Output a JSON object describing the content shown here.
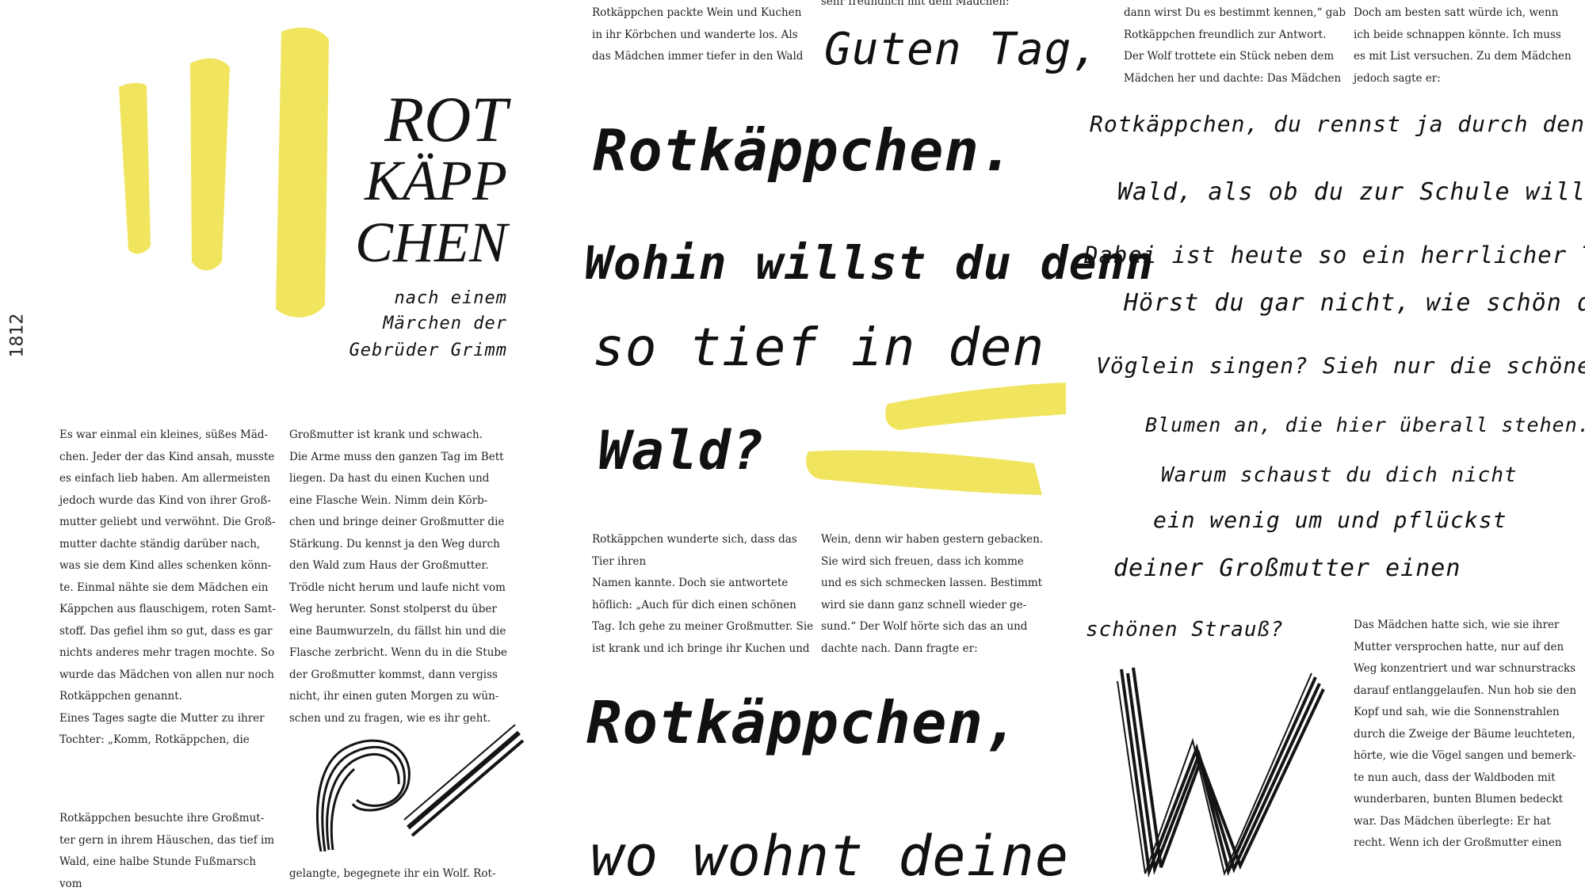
{
  "colors": {
    "accent_yellow": "#F1E45E",
    "ink": "#141414",
    "paper": "#FFFFFF"
  },
  "year": "1812",
  "title": {
    "line1": "ROT",
    "line2": "KÄPP",
    "line3": "CHEN",
    "subtitle_line1": "nach einem",
    "subtitle_line2": "Märchen der",
    "subtitle_line3": "Gebrüder Grimm"
  },
  "page1": {
    "col1_a": "Es war einmal ein kleines, süßes Mäd-\nchen. Jeder der das Kind ansah, musste\nes einfach lieb haben. Am allermeisten\njedoch wurde das Kind von ihrer Groß-\nmutter geliebt und verwöhnt. Die Groß-\nmutter dachte ständig darüber nach,\nwas sie dem Kind alles schenken könn-\nte. Einmal nähte sie dem Mädchen ein\nKäppchen aus flauschigem, roten Samt-\nstoff. Das gefiel ihm so gut, dass es gar\nnichts anderes mehr tragen mochte. So\nwurde das Mädchen von allen nur noch\nRotkäppchen genannt.\nEines Tages sagte die Mutter zu ihrer\nTochter: „Komm, Rotkäppchen, die",
    "col1_b": "Rotkäppchen besuchte ihre Großmut-\nter gern in ihrem Häuschen, das tief im\nWald, eine halbe Stunde Fußmarsch vom",
    "col2_a": "Großmutter ist krank und schwach.\nDie Arme muss den ganzen Tag im Bett\nliegen. Da hast du einen Kuchen und\neine Flasche Wein. Nimm dein Körb-\nchen und bringe deiner Großmutter die\nStärkung. Du kennst ja den Weg durch\nden Wald zum Haus der Großmutter.\nTrödle nicht herum und laufe nicht vom\nWeg herunter. Sonst stolperst du über\neine Baumwurzeln, du fällst hin und die\nFlasche zerbricht. Wenn du in die Stube\nder Großmutter kommst, dann vergiss\nnicht, ihr einen guten Morgen zu wün-\nschen und zu fragen, wie es ihr geht.",
    "col2_b": "gelangte, begegnete ihr ein Wolf. Rot-"
  },
  "page2": {
    "col1_top": "Rotkäppchen packte Wein und Kuchen\nin ihr Körbchen und wanderte los. Als\ndas Mädchen immer tiefer in den Wald",
    "col2_top": "sehr freundlich mit dem Mädchen:",
    "hand_guten_tag": "Guten Tag,",
    "hand_rotkappchen": "Rotkäppchen.",
    "hand_wohin": "Wohin willst du denn",
    "hand_so_tief": "so tief in den",
    "hand_wald": "Wald?",
    "col1_mid": "Rotkäppchen wunderte sich, dass das\nTier ihren\nNamen kannte. Doch sie antwortete\nhöflich: „Auch für dich einen schönen\nTag. Ich gehe zu meiner Großmutter. Sie\nist krank und ich bringe ihr Kuchen und",
    "col2_mid": "Wein, denn wir haben  gestern gebacken.\nSie wird sich freuen, dass ich komme\nund es sich schmecken lassen. Bestimmt\nwird sie dann ganz schnell wieder ge-\nsund.“ Der Wolf hörte sich das an und\ndachte nach. Dann fragte er:",
    "hand_rotkappchen2": "Rotkäppchen,",
    "hand_wo_wohnt": "wo wohnt deine"
  },
  "page3": {
    "col1_top": "dann wirst Du es bestimmt kennen,“ gab\nRotkäppchen freundlich zur Antwort.\nDer Wolf trottete ein Stück neben dem\nMädchen her und dachte: Das Mädchen",
    "col2_top": "Doch am besten satt würde ich, wenn\nich beide schnappen könnte. Ich muss\nes mit List versuchen.  Zu dem Mädchen\njedoch sagte er:",
    "hand_lines": [
      "Rotkäppchen, du rennst ja durch den",
      "Wald, als ob du zur Schule willst.",
      "Dabei ist heute so ein herrlicher Tag.",
      "Hörst du gar nicht, wie schön die",
      "Vöglein singen? Sieh nur die schönen",
      "Blumen an,   die hier  überall stehen.",
      "Warum schaust du   dich nicht",
      "ein  wenig   um  und  pflückst",
      "deiner Großmutter  einen",
      "schönen Strauß?"
    ],
    "col2_bottom": "Das Mädchen hatte sich, wie sie ihrer\nMutter versprochen hatte, nur auf den\nWeg konzentriert und war schnurstracks\ndarauf entlanggelaufen. Nun hob sie den\nKopf und sah, wie die Sonnenstrahlen\ndurch die Zweige der Bäume leuchteten,\nhörte, wie die Vögel sangen und bemerk-\nte nun auch, dass der Waldboden mit\nwunderbaren, bunten Blumen bedeckt\nwar. Das Mädchen überlegte: Er hat\nrecht. Wenn ich der Großmutter einen"
  },
  "decorations": {
    "yellow_strokes_icon": "yellow-brush-strokes",
    "letter_r_icon": "scribbled-letter-r",
    "letter_w_icon": "scribbled-letter-w"
  }
}
